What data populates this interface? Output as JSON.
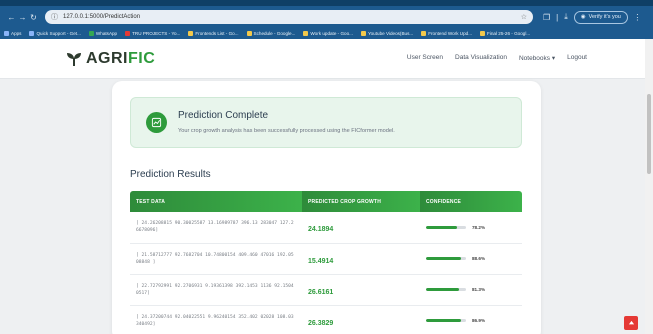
{
  "browser": {
    "url": "127.0.0.1:5000/PredictAction",
    "verify_label": "Verify it's you",
    "bookmarks": [
      {
        "label": "Apps",
        "color": "blue"
      },
      {
        "label": "Quick Support - Get...",
        "color": "blue"
      },
      {
        "label": "WhatsApp",
        "color": "green"
      },
      {
        "label": "TRU PROJECTS - Yo...",
        "color": "red"
      },
      {
        "label": "Frontends List - Go...",
        "color": "yellow"
      },
      {
        "label": "Schedule - Google...",
        "color": "yellow"
      },
      {
        "label": "Work update - Goo...",
        "color": "yellow"
      },
      {
        "label": "Youtube Videos(Bus...",
        "color": "yellow"
      },
      {
        "label": "Frontend Work Upd...",
        "color": "yellow"
      },
      {
        "label": "Final 25-26 - Googl...",
        "color": "yellow"
      }
    ]
  },
  "nav": {
    "brand_main": "AGRI",
    "brand_accent": "FIC",
    "links": [
      "User Screen",
      "Data Visualization",
      "Notebooks ▾",
      "Logout"
    ]
  },
  "alert": {
    "title": "Prediction Complete",
    "message": "Your crop growth analysis has been successfully processed using the FICformer model."
  },
  "results": {
    "title": "Prediction Results",
    "columns": [
      "TEST DATA",
      "PREDICTED CROP GROWTH",
      "CONFIDENCE"
    ],
    "rows": [
      {
        "test_data": "[ 24.26208815 90.30025587 13.16989787 396.13 283047 127.26678096]",
        "prediction": "24.1894",
        "confidence": "78.2%",
        "confidence_value": 0.782
      },
      {
        "test_data": "[ 21.58712777 92.7682704 10.74800154 409.460 47016 192.0508848 ]",
        "prediction": "15.4914",
        "confidence": "88.6%",
        "confidence_value": 0.886
      },
      {
        "test_data": "[ 22.72792991 92.2706931 9.19361398 392.1453 1136 92.15040517]",
        "prediction": "26.6161",
        "confidence": "81.3%",
        "confidence_value": 0.813
      },
      {
        "test_data": "[ 24.37200744 92.04022551 9.96240154 352.402 02028 108.03340492]",
        "prediction": "26.3829",
        "confidence": "86.9%",
        "confidence_value": 0.869
      }
    ]
  },
  "colors": {
    "brand_green": "#2e9b3c",
    "browser_blue": "#1d5a8f",
    "to_top_red": "#e53935"
  }
}
